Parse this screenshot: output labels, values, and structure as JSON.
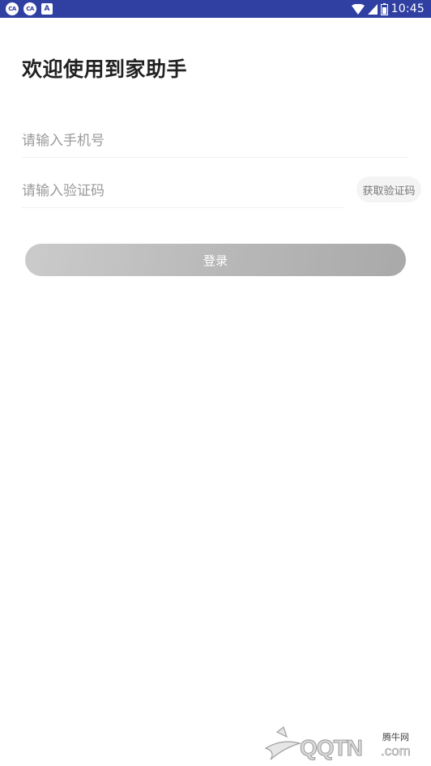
{
  "status_bar": {
    "badge1": "CA",
    "badge2": "CA",
    "badge3": "A",
    "time": "10:45",
    "background": "#2f3fa2"
  },
  "title": "欢迎使用到家助手",
  "phone_input": {
    "placeholder": "请输入手机号",
    "value": ""
  },
  "code_input": {
    "placeholder": "请输入验证码",
    "value": ""
  },
  "get_code_label": "获取验证码",
  "login_label": "登录",
  "watermark": {
    "text": "QQTN",
    "suffix": ".com",
    "cn": "腾牛网"
  }
}
